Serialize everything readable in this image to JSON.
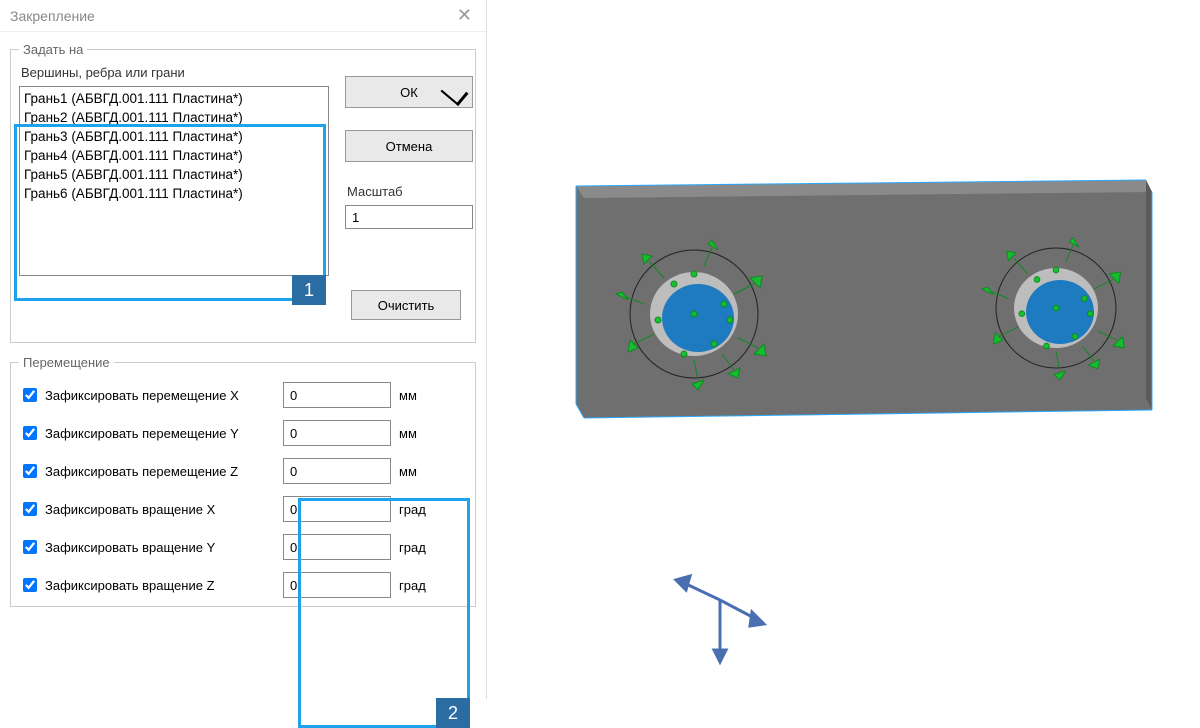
{
  "dialog": {
    "title": "Закрепление",
    "groups": {
      "apply_on": {
        "legend": "Задать на",
        "subtitle": "Вершины, ребра или грани",
        "items": [
          "Грань1 (АБВГД.001.111 Пластина*)",
          "Грань2 (АБВГД.001.111 Пластина*)",
          "Грань3 (АБВГД.001.111 Пластина*)",
          "Грань4 (АБВГД.001.111 Пластина*)",
          "Грань5 (АБВГД.001.111 Пластина*)",
          "Грань6 (АБВГД.001.111 Пластина*)"
        ],
        "clear_label": "Очистить"
      },
      "movement": {
        "legend": "Перемещение",
        "rows": [
          {
            "label": "Зафиксировать перемещение X",
            "checked": true,
            "value": "0",
            "unit": "мм"
          },
          {
            "label": "Зафиксировать перемещение Y",
            "checked": true,
            "value": "0",
            "unit": "мм"
          },
          {
            "label": "Зафиксировать перемещение Z",
            "checked": true,
            "value": "0",
            "unit": "мм"
          },
          {
            "label": "Зафиксировать вращение X",
            "checked": true,
            "value": "0",
            "unit": "град"
          },
          {
            "label": "Зафиксировать вращение Y",
            "checked": true,
            "value": "0",
            "unit": "град"
          },
          {
            "label": "Зафиксировать вращение Z",
            "checked": true,
            "value": "0",
            "unit": "град"
          }
        ]
      }
    },
    "buttons": {
      "ok": "ОК",
      "cancel": "Отмена"
    },
    "scale": {
      "label": "Масштаб",
      "value": "1"
    },
    "annotations": {
      "badge1": "1",
      "badge2": "2"
    }
  }
}
